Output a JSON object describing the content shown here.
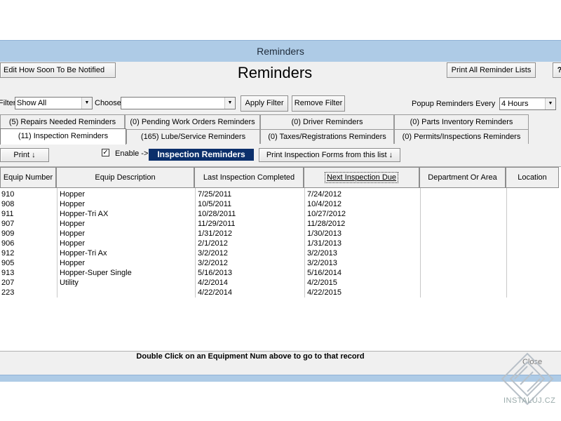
{
  "window": {
    "title": "Reminders"
  },
  "header": {
    "edit_button": "Edit How Soon To Be Notified",
    "heading": "Reminders",
    "print_all_button": "Print All Reminder Lists",
    "help_icon": "question-icon"
  },
  "filter": {
    "filter_label": "Filter",
    "filter_value": "Show All",
    "choose_label": "Choose",
    "choose_value": "",
    "apply_button": "Apply Filter",
    "remove_button": "Remove Filter",
    "popup_label": "Popup Reminders Every",
    "popup_value": "4 Hours"
  },
  "tabs_row1": [
    "(5) Repairs Needed Reminders",
    "(0) Pending Work Orders Reminders",
    "(0) Driver Reminders",
    "(0) Parts Inventory Reminders"
  ],
  "tabs_row2": [
    "(11) Inspection Reminders",
    "(165) Lube/Service Reminders",
    "(0) Taxes/Registrations Reminders",
    "(0) Permits/Inspections Reminders"
  ],
  "toolbar": {
    "print_button": "Print ↓",
    "enable_label": "Enable ->",
    "enable_checked": "✓",
    "section_title": "Inspection Reminders",
    "print_forms_button": "Print Inspection Forms from this list ↓"
  },
  "table": {
    "columns": [
      "Equip Number",
      "Equip Description",
      "Last Inspection Completed",
      "Next Inspection Due",
      "Department Or Area",
      "Location"
    ],
    "rows": [
      [
        "910",
        "Hopper",
        "7/25/2011",
        "7/24/2012",
        "",
        ""
      ],
      [
        "908",
        "Hopper",
        "10/5/2011",
        "10/4/2012",
        "",
        ""
      ],
      [
        "911",
        "Hopper-Tri AX",
        "10/28/2011",
        "10/27/2012",
        "",
        ""
      ],
      [
        "907",
        "Hopper",
        "11/29/2011",
        "11/28/2012",
        "",
        ""
      ],
      [
        "909",
        "Hopper",
        "1/31/2012",
        "1/30/2013",
        "",
        ""
      ],
      [
        "906",
        "Hopper",
        "2/1/2012",
        "1/31/2013",
        "",
        ""
      ],
      [
        "912",
        "Hopper-Tri Ax",
        "3/2/2012",
        "3/2/2013",
        "",
        ""
      ],
      [
        "905",
        "Hopper",
        "3/2/2012",
        "3/2/2013",
        "",
        ""
      ],
      [
        "913",
        "Hopper-Super Single",
        "5/16/2013",
        "5/16/2014",
        "",
        ""
      ],
      [
        "207",
        "Utility",
        "4/2/2014",
        "4/2/2015",
        "",
        ""
      ],
      [
        "223",
        "",
        "4/22/2014",
        "4/22/2015",
        "",
        ""
      ]
    ]
  },
  "footer": {
    "message": "Double Click on an Equipment Num above  to go to that record",
    "close_button": "Close"
  },
  "watermark": {
    "text": "INSTALUJ.CZ"
  }
}
